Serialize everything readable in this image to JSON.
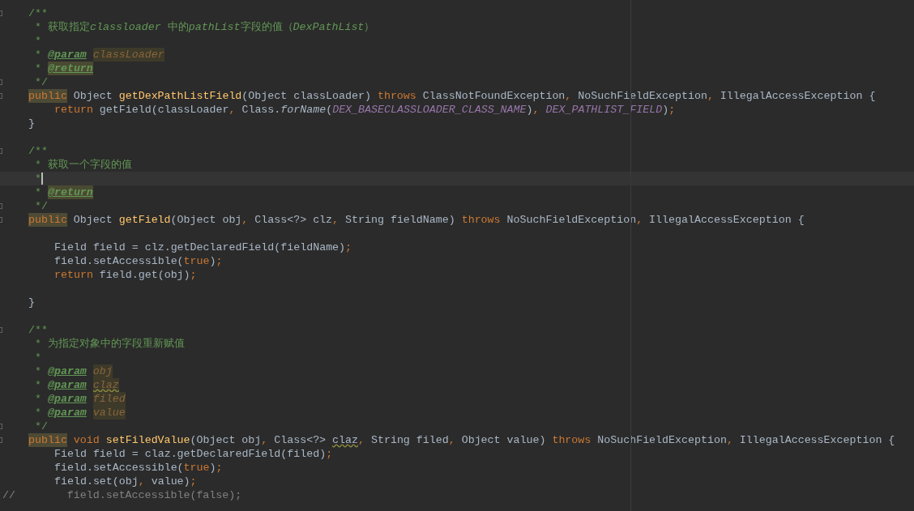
{
  "editor": {
    "lines": [
      {
        "kind": "member",
        "fold": true,
        "current": false,
        "tokens": [
          {
            "t": "/**",
            "kind": "doc"
          }
        ]
      },
      {
        "kind": "doc",
        "fold": false,
        "current": false,
        "tokens": [
          {
            "t": "* 获取指定",
            "kind": "doc"
          },
          {
            "t": "classloader",
            "kind": "docital"
          },
          {
            "t": " 中的",
            "kind": "doc"
          },
          {
            "t": "pathList",
            "kind": "docital"
          },
          {
            "t": "字段的值（",
            "kind": "doc"
          },
          {
            "t": "DexPathList",
            "kind": "docital"
          },
          {
            "t": "）",
            "kind": "doc"
          }
        ]
      },
      {
        "kind": "doc",
        "fold": false,
        "current": false,
        "tokens": [
          {
            "t": "*",
            "kind": "doc"
          }
        ]
      },
      {
        "kind": "doc",
        "fold": false,
        "current": false,
        "tokens": [
          {
            "t": "* ",
            "kind": "doc"
          },
          {
            "t": "@param",
            "kind": "tag"
          },
          {
            "t": "classLoader",
            "kind": "param"
          }
        ]
      },
      {
        "kind": "doc",
        "fold": false,
        "current": false,
        "tokens": [
          {
            "t": "* ",
            "kind": "doc"
          },
          {
            "t": "@return",
            "kind": "taghl"
          }
        ]
      },
      {
        "kind": "doc",
        "fold": true,
        "current": false,
        "tokens": [
          {
            "t": "*/",
            "kind": "doc"
          }
        ]
      },
      {
        "kind": "member",
        "fold": true,
        "current": false,
        "tokens": [
          {
            "t": "public",
            "kind": "kwhl"
          },
          {
            "t": " Object ",
            "kind": "plain"
          },
          {
            "t": "getDexPathListField",
            "kind": "fn"
          },
          {
            "t": "(Object classLoader) ",
            "kind": "plain"
          },
          {
            "t": "throws",
            "kind": "kw"
          },
          {
            "t": " ClassNotFoundException",
            "kind": "plain"
          },
          {
            "t": ",",
            "kind": "kw"
          },
          {
            "t": " NoSuchFieldException",
            "kind": "plain"
          },
          {
            "t": ",",
            "kind": "kw"
          },
          {
            "t": " IllegalAccessException {",
            "kind": "plain"
          }
        ]
      },
      {
        "kind": "body",
        "fold": false,
        "current": false,
        "tokens": [
          {
            "t": "return",
            "kind": "kw"
          },
          {
            "t": " getField(classLoader",
            "kind": "plain"
          },
          {
            "t": ",",
            "kind": "kw"
          },
          {
            "t": " Class.",
            "kind": "plain"
          },
          {
            "t": "forName",
            "kind": "ital"
          },
          {
            "t": "(",
            "kind": "plain"
          },
          {
            "t": "DEX_BASECLASSLOADER_CLASS_NAME",
            "kind": "const"
          },
          {
            "t": ")",
            "kind": "plain"
          },
          {
            "t": ", ",
            "kind": "kw"
          },
          {
            "t": "DEX_PATHLIST_FIELD",
            "kind": "const"
          },
          {
            "t": ")",
            "kind": "plain"
          },
          {
            "t": ";",
            "kind": "kw"
          }
        ]
      },
      {
        "kind": "member",
        "fold": false,
        "current": false,
        "tokens": [
          {
            "t": "}",
            "kind": "plain"
          }
        ]
      },
      {
        "kind": "blank",
        "fold": false,
        "current": false
      },
      {
        "kind": "member",
        "fold": true,
        "current": false,
        "tokens": [
          {
            "t": "/**",
            "kind": "doc"
          }
        ]
      },
      {
        "kind": "doc",
        "fold": false,
        "current": false,
        "tokens": [
          {
            "t": "* 获取一个字段的值",
            "kind": "doc"
          }
        ]
      },
      {
        "kind": "doc",
        "fold": false,
        "current": true,
        "tokens": [
          {
            "t": "*",
            "kind": "doc"
          }
        ]
      },
      {
        "kind": "doc",
        "fold": false,
        "current": false,
        "tokens": [
          {
            "t": "* ",
            "kind": "doc"
          },
          {
            "t": "@return",
            "kind": "taghl"
          }
        ]
      },
      {
        "kind": "doc",
        "fold": true,
        "current": false,
        "tokens": [
          {
            "t": "*/",
            "kind": "doc"
          }
        ]
      },
      {
        "kind": "member",
        "fold": true,
        "current": false,
        "tokens": [
          {
            "t": "public",
            "kind": "kwhl"
          },
          {
            "t": " Object ",
            "kind": "plain"
          },
          {
            "t": "getField",
            "kind": "fn"
          },
          {
            "t": "(Object obj",
            "kind": "plain"
          },
          {
            "t": ",",
            "kind": "kw"
          },
          {
            "t": " Class<?> clz",
            "kind": "plain"
          },
          {
            "t": ",",
            "kind": "kw"
          },
          {
            "t": " String fieldName) ",
            "kind": "plain"
          },
          {
            "t": "throws",
            "kind": "kw"
          },
          {
            "t": " NoSuchFieldException",
            "kind": "plain"
          },
          {
            "t": ",",
            "kind": "kw"
          },
          {
            "t": " IllegalAccessException {",
            "kind": "plain"
          }
        ]
      },
      {
        "kind": "blank",
        "fold": false,
        "current": false
      },
      {
        "kind": "body",
        "fold": false,
        "current": false,
        "tokens": [
          {
            "t": "Field field = clz.getDeclaredField(fieldName)",
            "kind": "plain"
          },
          {
            "t": ";",
            "kind": "kw"
          }
        ]
      },
      {
        "kind": "body",
        "fold": false,
        "current": false,
        "tokens": [
          {
            "t": "field.setAccessible(",
            "kind": "plain"
          },
          {
            "t": "true",
            "kind": "kw"
          },
          {
            "t": ")",
            "kind": "plain"
          },
          {
            "t": ";",
            "kind": "kw"
          }
        ]
      },
      {
        "kind": "body",
        "fold": false,
        "current": false,
        "tokens": [
          {
            "t": "return",
            "kind": "kw"
          },
          {
            "t": " field.get(obj)",
            "kind": "plain"
          },
          {
            "t": ";",
            "kind": "kw"
          }
        ]
      },
      {
        "kind": "blank",
        "fold": false,
        "current": false
      },
      {
        "kind": "member",
        "fold": false,
        "current": false,
        "tokens": [
          {
            "t": "}",
            "kind": "plain"
          }
        ]
      },
      {
        "kind": "blank",
        "fold": false,
        "current": false
      },
      {
        "kind": "member",
        "fold": true,
        "current": false,
        "tokens": [
          {
            "t": "/**",
            "kind": "doc"
          }
        ]
      },
      {
        "kind": "doc",
        "fold": false,
        "current": false,
        "tokens": [
          {
            "t": "* 为指定对象中的字段重新赋值",
            "kind": "doc"
          }
        ]
      },
      {
        "kind": "doc",
        "fold": false,
        "current": false,
        "tokens": [
          {
            "t": "*",
            "kind": "doc"
          }
        ]
      },
      {
        "kind": "doc",
        "fold": false,
        "current": false,
        "tokens": [
          {
            "t": "* ",
            "kind": "doc"
          },
          {
            "t": "@param",
            "kind": "tag"
          },
          {
            "t": "obj",
            "kind": "param"
          }
        ]
      },
      {
        "kind": "doc",
        "fold": false,
        "current": false,
        "tokens": [
          {
            "t": "* ",
            "kind": "doc"
          },
          {
            "t": "@param",
            "kind": "tag"
          },
          {
            "t": "claz",
            "kind": "paramwarn"
          }
        ]
      },
      {
        "kind": "doc",
        "fold": false,
        "current": false,
        "tokens": [
          {
            "t": "* ",
            "kind": "doc"
          },
          {
            "t": "@param",
            "kind": "tag"
          },
          {
            "t": "filed",
            "kind": "param"
          }
        ]
      },
      {
        "kind": "doc",
        "fold": false,
        "current": false,
        "tokens": [
          {
            "t": "* ",
            "kind": "doc"
          },
          {
            "t": "@param",
            "kind": "tag"
          },
          {
            "t": "value",
            "kind": "param"
          }
        ]
      },
      {
        "kind": "doc",
        "fold": true,
        "current": false,
        "tokens": [
          {
            "t": "*/",
            "kind": "doc"
          }
        ]
      },
      {
        "kind": "member",
        "fold": true,
        "current": false,
        "tokens": [
          {
            "t": "public",
            "kind": "kwhl"
          },
          {
            "t": " void ",
            "kind": "kw"
          },
          {
            "t": "setFiledValue",
            "kind": "fn"
          },
          {
            "t": "(Object obj",
            "kind": "plain"
          },
          {
            "t": ",",
            "kind": "kw"
          },
          {
            "t": " Class<?> ",
            "kind": "plain"
          },
          {
            "t": "claz",
            "kind": "warn"
          },
          {
            "t": ",",
            "kind": "kw"
          },
          {
            "t": " String filed",
            "kind": "plain"
          },
          {
            "t": ",",
            "kind": "kw"
          },
          {
            "t": " Object value) ",
            "kind": "plain"
          },
          {
            "t": "throws",
            "kind": "kw"
          },
          {
            "t": " NoSuchFieldException",
            "kind": "plain"
          },
          {
            "t": ",",
            "kind": "kw"
          },
          {
            "t": " IllegalAccessException {",
            "kind": "plain"
          }
        ]
      },
      {
        "kind": "body",
        "fold": false,
        "current": false,
        "tokens": [
          {
            "t": "Field field = claz.getDeclaredField(filed)",
            "kind": "plain"
          },
          {
            "t": ";",
            "kind": "kw"
          }
        ]
      },
      {
        "kind": "body",
        "fold": false,
        "current": false,
        "tokens": [
          {
            "t": "field.setAccessible(",
            "kind": "plain"
          },
          {
            "t": "true",
            "kind": "kw"
          },
          {
            "t": ")",
            "kind": "plain"
          },
          {
            "t": ";",
            "kind": "kw"
          }
        ]
      },
      {
        "kind": "body",
        "fold": false,
        "current": false,
        "tokens": [
          {
            "t": "field.set(obj",
            "kind": "plain"
          },
          {
            "t": ",",
            "kind": "kw"
          },
          {
            "t": " value)",
            "kind": "plain"
          },
          {
            "t": ";",
            "kind": "kw"
          }
        ]
      },
      {
        "kind": "comment",
        "fold": false,
        "current": false,
        "tokens": [
          {
            "t": "//        field.setAccessible(false);",
            "kind": "linecomment"
          }
        ]
      }
    ]
  }
}
